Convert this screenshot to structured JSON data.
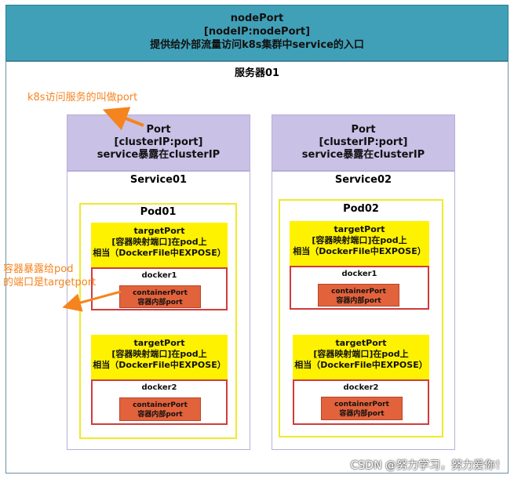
{
  "header": {
    "line1": "nodePort",
    "line2": "[nodeIP:nodePort]",
    "line3": "提供给外部流量访问k8s集群中service的入口"
  },
  "server": {
    "title": "服务器01"
  },
  "annotations": {
    "port_note": "k8s访问服务的叫做port",
    "target_note_line1": "容器暴露给pod",
    "target_note_line2": "的端口是targetport"
  },
  "services": [
    {
      "header_line1": "Port",
      "header_line2": "[clusterIP:port]",
      "header_line3": "service暴露在clusterIP",
      "title": "Service01",
      "pod_title": "Pod01",
      "containers": [
        {
          "tp_line1": "targetPort",
          "tp_line2": "[容器映射端口]在pod上",
          "tp_line3": "相当（DockerFile中EXPOSE）",
          "docker": "docker1",
          "cp_line1": "containerPort",
          "cp_line2": "容器内部port"
        },
        {
          "tp_line1": "targetPort",
          "tp_line2": "[容器映射端口]在pod上",
          "tp_line3": "相当（DockerFile中EXPOSE）",
          "docker": "docker2",
          "cp_line1": "containerPort",
          "cp_line2": "容器内部port"
        }
      ]
    },
    {
      "header_line1": "Port",
      "header_line2": "[clusterIP:port]",
      "header_line3": "service暴露在clusterIP",
      "title": "Service02",
      "pod_title": "Pod02",
      "containers": [
        {
          "tp_line1": "targetPort",
          "tp_line2": "[容器映射端口]在pod上",
          "tp_line3": "相当（DockerFile中EXPOSE）",
          "docker": "docker1",
          "cp_line1": "containerPort",
          "cp_line2": "容器内部port"
        },
        {
          "tp_line1": "targetPort",
          "tp_line2": "[容器映射端口]在pod上",
          "tp_line3": "相当（DockerFile中EXPOSE）",
          "docker": "docker2",
          "cp_line1": "containerPort",
          "cp_line2": "容器内部port"
        }
      ]
    }
  ],
  "watermark": "CSDN @努力学习，努力爱你！",
  "colors": {
    "header_bg": "#40a0b7",
    "service_header_bg": "#c9c1e6",
    "pod_border": "#f0ea2a",
    "target_port_bg": "#fff200",
    "docker_border": "#d23b3b",
    "container_port_bg": "#e2623c",
    "annotation": "#f5841f"
  }
}
